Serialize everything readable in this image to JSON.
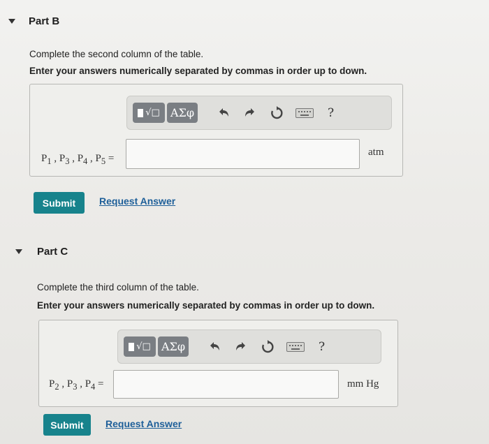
{
  "parts": [
    {
      "title": "Part B",
      "instruction": "Complete the second column of the table.",
      "instruction_bold": "Enter your answers numerically separated by commas in order up to down.",
      "toolbar": {
        "greek_label": "ΑΣφ",
        "help_label": "?"
      },
      "variable_label": "P1 , P3 , P4 , P5 =",
      "input_value": "",
      "unit": "atm",
      "submit_label": "Submit",
      "request_label": "Request Answer"
    },
    {
      "title": "Part C",
      "instruction": "Complete the third column of the table.",
      "instruction_bold": "Enter your answers numerically separated by commas in order up to down.",
      "toolbar": {
        "greek_label": "ΑΣφ",
        "help_label": "?"
      },
      "variable_label": "P2 , P3 , P4 =",
      "input_value": "",
      "unit": "mm Hg",
      "submit_label": "Submit",
      "request_label": "Request Answer"
    }
  ],
  "icons": [
    "template-icon",
    "undo-icon",
    "redo-icon",
    "reset-icon",
    "keyboard-icon",
    "help-icon"
  ]
}
